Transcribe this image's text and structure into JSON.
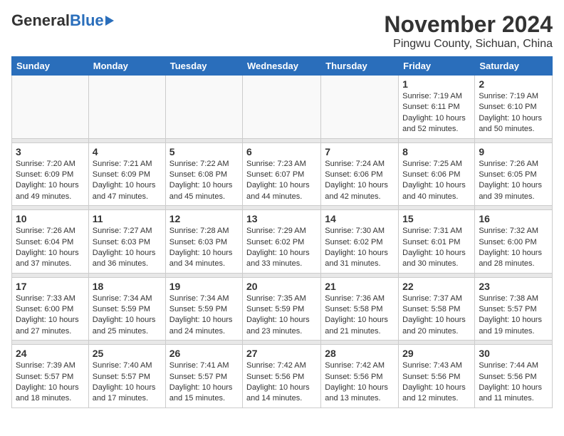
{
  "header": {
    "logo_general": "General",
    "logo_blue": "Blue",
    "month_title": "November 2024",
    "location": "Pingwu County, Sichuan, China"
  },
  "weekdays": [
    "Sunday",
    "Monday",
    "Tuesday",
    "Wednesday",
    "Thursday",
    "Friday",
    "Saturday"
  ],
  "weeks": [
    [
      {
        "day": "",
        "info": ""
      },
      {
        "day": "",
        "info": ""
      },
      {
        "day": "",
        "info": ""
      },
      {
        "day": "",
        "info": ""
      },
      {
        "day": "",
        "info": ""
      },
      {
        "day": "1",
        "info": "Sunrise: 7:19 AM\nSunset: 6:11 PM\nDaylight: 10 hours\nand 52 minutes."
      },
      {
        "day": "2",
        "info": "Sunrise: 7:19 AM\nSunset: 6:10 PM\nDaylight: 10 hours\nand 50 minutes."
      }
    ],
    [
      {
        "day": "3",
        "info": "Sunrise: 7:20 AM\nSunset: 6:09 PM\nDaylight: 10 hours\nand 49 minutes."
      },
      {
        "day": "4",
        "info": "Sunrise: 7:21 AM\nSunset: 6:09 PM\nDaylight: 10 hours\nand 47 minutes."
      },
      {
        "day": "5",
        "info": "Sunrise: 7:22 AM\nSunset: 6:08 PM\nDaylight: 10 hours\nand 45 minutes."
      },
      {
        "day": "6",
        "info": "Sunrise: 7:23 AM\nSunset: 6:07 PM\nDaylight: 10 hours\nand 44 minutes."
      },
      {
        "day": "7",
        "info": "Sunrise: 7:24 AM\nSunset: 6:06 PM\nDaylight: 10 hours\nand 42 minutes."
      },
      {
        "day": "8",
        "info": "Sunrise: 7:25 AM\nSunset: 6:06 PM\nDaylight: 10 hours\nand 40 minutes."
      },
      {
        "day": "9",
        "info": "Sunrise: 7:26 AM\nSunset: 6:05 PM\nDaylight: 10 hours\nand 39 minutes."
      }
    ],
    [
      {
        "day": "10",
        "info": "Sunrise: 7:26 AM\nSunset: 6:04 PM\nDaylight: 10 hours\nand 37 minutes."
      },
      {
        "day": "11",
        "info": "Sunrise: 7:27 AM\nSunset: 6:03 PM\nDaylight: 10 hours\nand 36 minutes."
      },
      {
        "day": "12",
        "info": "Sunrise: 7:28 AM\nSunset: 6:03 PM\nDaylight: 10 hours\nand 34 minutes."
      },
      {
        "day": "13",
        "info": "Sunrise: 7:29 AM\nSunset: 6:02 PM\nDaylight: 10 hours\nand 33 minutes."
      },
      {
        "day": "14",
        "info": "Sunrise: 7:30 AM\nSunset: 6:02 PM\nDaylight: 10 hours\nand 31 minutes."
      },
      {
        "day": "15",
        "info": "Sunrise: 7:31 AM\nSunset: 6:01 PM\nDaylight: 10 hours\nand 30 minutes."
      },
      {
        "day": "16",
        "info": "Sunrise: 7:32 AM\nSunset: 6:00 PM\nDaylight: 10 hours\nand 28 minutes."
      }
    ],
    [
      {
        "day": "17",
        "info": "Sunrise: 7:33 AM\nSunset: 6:00 PM\nDaylight: 10 hours\nand 27 minutes."
      },
      {
        "day": "18",
        "info": "Sunrise: 7:34 AM\nSunset: 5:59 PM\nDaylight: 10 hours\nand 25 minutes."
      },
      {
        "day": "19",
        "info": "Sunrise: 7:34 AM\nSunset: 5:59 PM\nDaylight: 10 hours\nand 24 minutes."
      },
      {
        "day": "20",
        "info": "Sunrise: 7:35 AM\nSunset: 5:59 PM\nDaylight: 10 hours\nand 23 minutes."
      },
      {
        "day": "21",
        "info": "Sunrise: 7:36 AM\nSunset: 5:58 PM\nDaylight: 10 hours\nand 21 minutes."
      },
      {
        "day": "22",
        "info": "Sunrise: 7:37 AM\nSunset: 5:58 PM\nDaylight: 10 hours\nand 20 minutes."
      },
      {
        "day": "23",
        "info": "Sunrise: 7:38 AM\nSunset: 5:57 PM\nDaylight: 10 hours\nand 19 minutes."
      }
    ],
    [
      {
        "day": "24",
        "info": "Sunrise: 7:39 AM\nSunset: 5:57 PM\nDaylight: 10 hours\nand 18 minutes."
      },
      {
        "day": "25",
        "info": "Sunrise: 7:40 AM\nSunset: 5:57 PM\nDaylight: 10 hours\nand 17 minutes."
      },
      {
        "day": "26",
        "info": "Sunrise: 7:41 AM\nSunset: 5:57 PM\nDaylight: 10 hours\nand 15 minutes."
      },
      {
        "day": "27",
        "info": "Sunrise: 7:42 AM\nSunset: 5:56 PM\nDaylight: 10 hours\nand 14 minutes."
      },
      {
        "day": "28",
        "info": "Sunrise: 7:42 AM\nSunset: 5:56 PM\nDaylight: 10 hours\nand 13 minutes."
      },
      {
        "day": "29",
        "info": "Sunrise: 7:43 AM\nSunset: 5:56 PM\nDaylight: 10 hours\nand 12 minutes."
      },
      {
        "day": "30",
        "info": "Sunrise: 7:44 AM\nSunset: 5:56 PM\nDaylight: 10 hours\nand 11 minutes."
      }
    ]
  ]
}
